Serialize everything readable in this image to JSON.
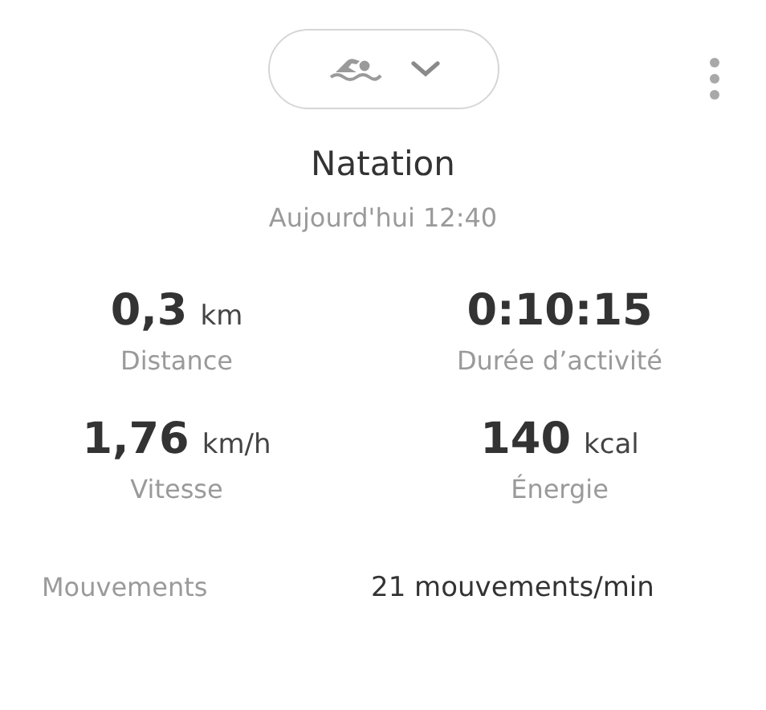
{
  "activity_selector": {
    "kind": "swimming"
  },
  "title": "Natation",
  "date": "Aujourd'hui 12:40",
  "stats": [
    {
      "value": "0,3",
      "unit": "km",
      "label": "Distance"
    },
    {
      "value": "0:10:15",
      "label": "Durée d’activité"
    },
    {
      "value": "1,76",
      "unit": "km/h",
      "label": "Vitesse"
    },
    {
      "value": "140",
      "unit": "kcal",
      "label": "Énergie"
    }
  ],
  "details": [
    {
      "label": "Mouvements",
      "value": "21 mouvements/min"
    }
  ]
}
